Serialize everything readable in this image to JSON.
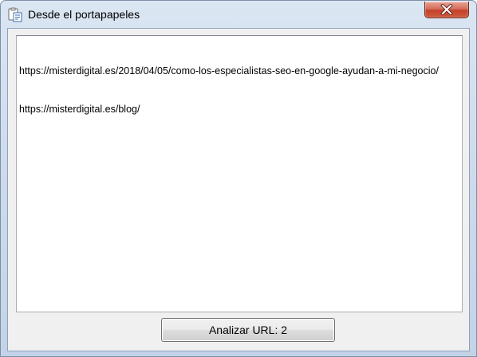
{
  "window": {
    "title": "Desde el portapapeles",
    "title_icon": "clipboard-paste-icon",
    "close_icon": "close-icon"
  },
  "textarea": {
    "lines": [
      "https://misterdigital.es/2018/04/05/como-los-especialistas-seo-en-google-ayudan-a-mi-negocio/",
      "https://misterdigital.es/blog/"
    ]
  },
  "actions": {
    "analyze_label": "Analizar URL: 2"
  },
  "colors": {
    "close_button_red": "#c4412a",
    "frame_blue": "#cfdcec",
    "client_gray": "#f0f0f0"
  }
}
